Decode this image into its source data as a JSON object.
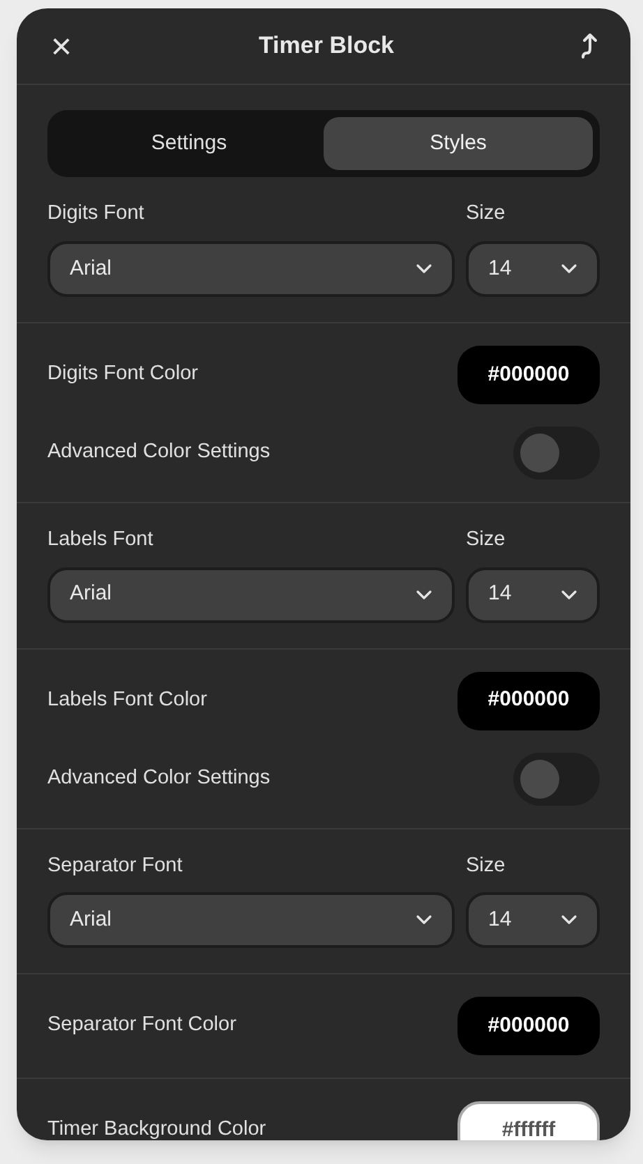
{
  "header": {
    "close": "×",
    "title": "Timer Block"
  },
  "tabs": [
    {
      "label": "Settings",
      "selected": false
    },
    {
      "label": "Styles",
      "selected": true
    }
  ],
  "sections": [
    {
      "kind": "font",
      "label": "Digits Font",
      "font": "Arial",
      "size_label": "Size",
      "size": "14"
    },
    {
      "kind": "color",
      "label": "Digits Font Color",
      "value": "#000000",
      "advanced": {
        "label": "Advanced Color Settings",
        "on": false
      }
    },
    {
      "kind": "font",
      "label": "Labels Font",
      "font": "Arial",
      "size_label": "Size",
      "size": "14"
    },
    {
      "kind": "color",
      "label": "Labels Font Color",
      "value": "#000000",
      "advanced": {
        "label": "Advanced Color Settings",
        "on": false
      }
    },
    {
      "kind": "font",
      "label": "Separator Font",
      "font": "Arial",
      "size_label": "Size",
      "size": "14"
    },
    {
      "kind": "color",
      "label": "Separator Font Color",
      "value": "#000000"
    },
    {
      "kind": "color",
      "label": "Timer Background Color",
      "value": "#ffffff"
    }
  ]
}
